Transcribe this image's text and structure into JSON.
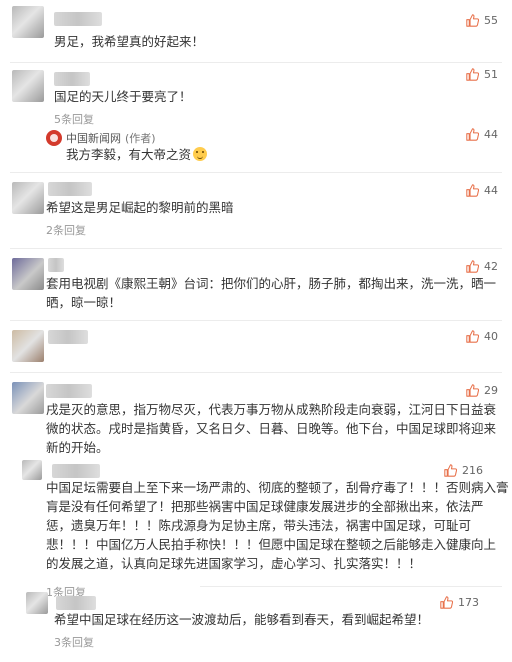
{
  "comments": [
    {
      "text": "男足，我希望真的好起来！",
      "likes": "55"
    },
    {
      "text": "国足的天儿终于要亮了！",
      "likes": "51",
      "replies": "5条回复",
      "reply": {
        "user": "中国新闻网",
        "author_tag": "(作者)",
        "text": "我方李毅，有大帝之资",
        "likes": "44"
      }
    },
    {
      "text": "希望这是男足崛起的黎明前的黑暗",
      "likes": "44",
      "replies": "2条回复"
    },
    {
      "text_line1": "套用电视剧《康熙王朝》台词：把你们的心肝，肠子肺，都掏出来，洗一洗，晒一",
      "text_line2": "晒，晾一晾！",
      "likes": "42"
    },
    {
      "likes": "40"
    },
    {
      "text_line1": "戌是灭的意思，指万物尽灭，代表万事万物从成熟阶段走向衰弱，江河日下日益衰",
      "text_line2": "微的状态。戌时是指黄昏，又名日夕、日暮、日晚等。他下台，中国足球即将迎来",
      "text_line3": "新的开始。",
      "likes": "29",
      "reply": {
        "likes": "216",
        "replies": "1条回复",
        "lines": [
          "中国足坛需要自上至下来一场严肃的、彻底的整顿了，刮骨疗毒了！！！否则病入膏",
          "肓是没有任何希望了！把那些祸害中国足球健康发展进步的全部揪出来，依法严",
          "惩，遗臭万年！！！陈戌源身为足协主席，带头违法，祸害中国足球，可耻可",
          "悲！！！中国亿万人民拍手称快！！！但愿中国足球在整顿之后能够走入健康向上",
          "的发展之道，认真向足球先进国家学习，虚心学习、扎实落实！！！"
        ]
      }
    },
    {
      "text": "希望中国足球在经历这一波渡劫后，能够看到春天，看到崛起希望！",
      "likes": "173",
      "replies": "3条回复"
    }
  ]
}
